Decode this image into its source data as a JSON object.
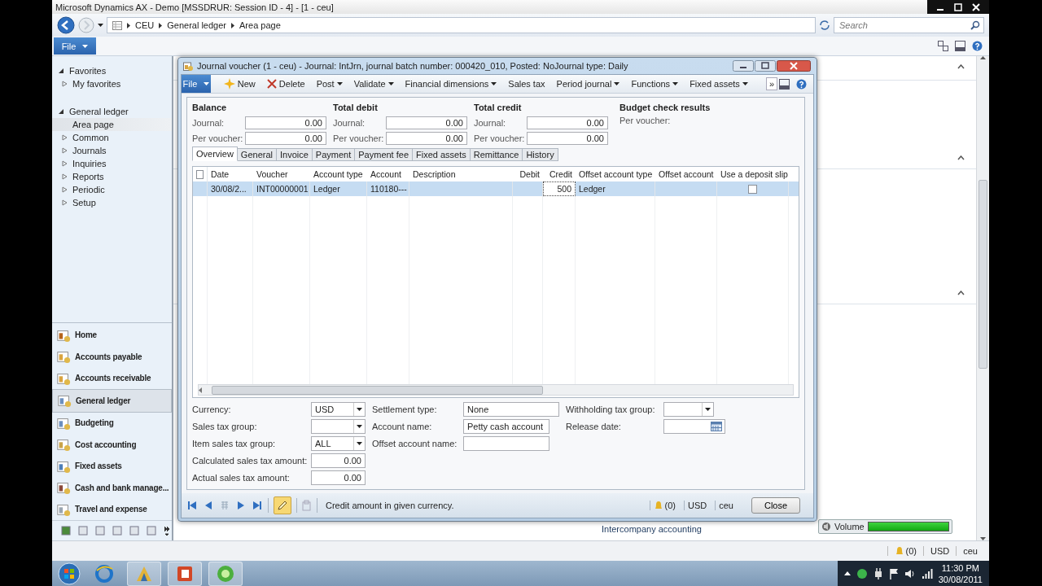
{
  "app_window": {
    "title": "Microsoft Dynamics AX - Demo [MSSDRUR: Session ID - 4] -  [1 - ceu]"
  },
  "address_bar": {
    "breadcrumb": [
      "CEU",
      "General ledger",
      "Area page"
    ],
    "search": {
      "placeholder": "Search"
    }
  },
  "ribbon": {
    "file_button": "File"
  },
  "nav_tree": [
    {
      "label": "Favorites",
      "expanded": true,
      "children": [
        {
          "label": "My favorites",
          "kind": "folder",
          "selected": false
        }
      ]
    },
    {
      "label": "General ledger",
      "expanded": true,
      "children": [
        {
          "label": "Area page",
          "kind": "page",
          "selected": true
        },
        {
          "label": "Common",
          "kind": "folder",
          "selected": false
        },
        {
          "label": "Journals",
          "kind": "folder",
          "selected": false
        },
        {
          "label": "Inquiries",
          "kind": "folder",
          "selected": false
        },
        {
          "label": "Reports",
          "kind": "folder",
          "selected": false
        },
        {
          "label": "Periodic",
          "kind": "folder",
          "selected": false
        },
        {
          "label": "Setup",
          "kind": "folder",
          "selected": false
        }
      ]
    }
  ],
  "modules": [
    {
      "label": "Home",
      "selected": false
    },
    {
      "label": "Accounts payable",
      "selected": false
    },
    {
      "label": "Accounts receivable",
      "selected": false
    },
    {
      "label": "General ledger",
      "selected": true
    },
    {
      "label": "Budgeting",
      "selected": false
    },
    {
      "label": "Cost accounting",
      "selected": false
    },
    {
      "label": "Fixed assets",
      "selected": false
    },
    {
      "label": "Cash and bank manage...",
      "selected": false
    },
    {
      "label": "Travel and expense",
      "selected": false
    }
  ],
  "content": {
    "links": [
      "Intercompany accounting"
    ]
  },
  "volume": {
    "label": "Volume",
    "level": 1
  },
  "status_bar": {
    "alerts": "(0)",
    "currency": "USD",
    "company": "ceu"
  },
  "taskbar": {
    "time": "11:30 PM",
    "date": "30/08/2011"
  },
  "journal_window": {
    "title": "Journal voucher (1 - ceu) - Journal: IntJrn, journal batch number: 000420_010, Posted: NoJournal type: Daily",
    "toolbar": [
      {
        "label": "File",
        "kind": "file"
      },
      {
        "label": "New",
        "kind": "create"
      },
      {
        "label": "Delete",
        "kind": "remove"
      },
      {
        "label": "Post",
        "kind": "menu"
      },
      {
        "label": "Validate",
        "kind": "menu"
      },
      {
        "label": "Financial dimensions",
        "kind": "menu"
      },
      {
        "label": "Sales tax",
        "kind": "plain"
      },
      {
        "label": "Period journal",
        "kind": "menu"
      },
      {
        "label": "Functions",
        "kind": "menu"
      },
      {
        "label": "Fixed assets",
        "kind": "menu"
      },
      {
        "label": "»",
        "kind": "overflow"
      }
    ],
    "totals": [
      {
        "heading": "Balance",
        "fields": [
          {
            "label": "Journal:",
            "value": "0.00"
          },
          {
            "label": "Per voucher:",
            "value": "0.00"
          }
        ]
      },
      {
        "heading": "Total debit",
        "fields": [
          {
            "label": "Journal:",
            "value": "0.00"
          },
          {
            "label": "Per voucher:",
            "value": "0.00"
          }
        ]
      },
      {
        "heading": "Total credit",
        "fields": [
          {
            "label": "Journal:",
            "value": "0.00"
          },
          {
            "label": "Per voucher:",
            "value": "0.00"
          }
        ]
      }
    ],
    "budget_check": {
      "heading": "Budget check results",
      "label": "Per voucher:"
    },
    "tabs": [
      {
        "label": "Overview",
        "selected": true
      },
      {
        "label": "General",
        "selected": false
      },
      {
        "label": "Invoice",
        "selected": false
      },
      {
        "label": "Payment",
        "selected": false
      },
      {
        "label": "Payment fee",
        "selected": false
      },
      {
        "label": "Fixed assets",
        "selected": false
      },
      {
        "label": "Remittance",
        "selected": false
      },
      {
        "label": "History",
        "selected": false
      }
    ],
    "grid": {
      "all_checked": false,
      "columns": [
        {
          "label": "Date",
          "kind": "text"
        },
        {
          "label": "Voucher",
          "kind": "text"
        },
        {
          "label": "Account type",
          "kind": "text"
        },
        {
          "label": "Account",
          "kind": "text"
        },
        {
          "label": "Description",
          "kind": "text"
        },
        {
          "label": "Debit",
          "kind": "amount"
        },
        {
          "label": "Credit",
          "kind": "amount"
        },
        {
          "label": "Offset account type",
          "kind": "text"
        },
        {
          "label": "Offset account",
          "kind": "text"
        },
        {
          "label": "Use a deposit slip",
          "kind": "checkbox"
        }
      ],
      "rows": [
        {
          "selected": true,
          "cells": [
            "30/08/2...",
            "INT00000001",
            "Ledger",
            "110180---",
            null,
            null,
            "500",
            "Ledger",
            null
          ],
          "checked": false
        }
      ]
    },
    "form": [
      [
        {
          "label": "Currency:",
          "value": "USD",
          "kind": "combo"
        },
        {
          "label": "Sales tax group:",
          "kind": "combo"
        },
        {
          "label": "Item sales tax group:",
          "value": "ALL",
          "kind": "combo"
        },
        {
          "label": "Calculated sales tax amount:",
          "value": "0.00",
          "kind": "amount"
        },
        {
          "label": "Actual sales tax amount:",
          "value": "0.00",
          "kind": "amount"
        }
      ],
      [
        {
          "label": "Settlement type:",
          "value": "None",
          "kind": "text"
        },
        {
          "label": "Account name:",
          "value": "Petty cash account",
          "kind": "text"
        },
        {
          "label": "Offset account name:",
          "kind": "text"
        }
      ],
      [
        {
          "label": "Withholding tax group:",
          "kind": "combo"
        },
        {
          "label": "Release date:",
          "kind": "date"
        }
      ]
    ],
    "footer": {
      "edit_mode": true,
      "status_text": "Credit amount in given currency.",
      "alerts": "(0)",
      "currency": "USD",
      "company": "ceu",
      "close_button": "Close"
    }
  }
}
